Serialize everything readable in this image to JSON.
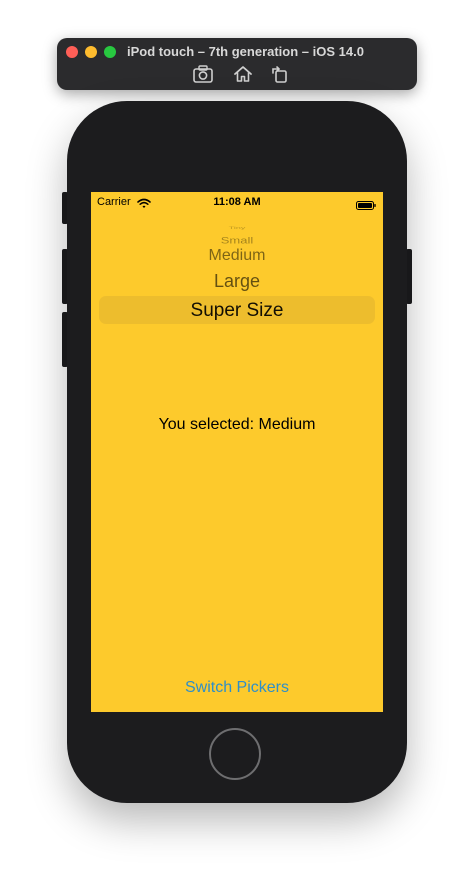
{
  "simulator": {
    "title": "iPod touch – 7th generation – iOS 14.0",
    "toolbar_icons": [
      "screenshot-icon",
      "home-icon",
      "rotate-icon"
    ]
  },
  "status_bar": {
    "carrier": "Carrier",
    "time": "11:08 AM"
  },
  "picker": {
    "items": [
      "Tiny",
      "Small",
      "Medium",
      "Large",
      "Super Size"
    ],
    "highlighted": "Super Size"
  },
  "result": {
    "text": "You selected: Medium"
  },
  "switch_button": {
    "label": "Switch Pickers"
  },
  "colors": {
    "screen_background": "#fdca2c",
    "link": "#2f8fc8",
    "device_body": "#1c1c1e"
  }
}
